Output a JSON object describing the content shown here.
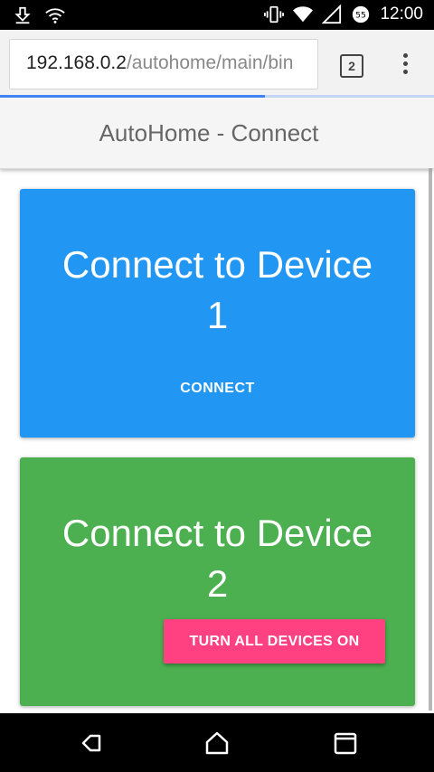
{
  "status_bar": {
    "time": "12:00",
    "battery_level": "55",
    "icons": [
      "download-icon",
      "wifi-icon",
      "vibrate-icon",
      "wifi-signal-icon",
      "cell-signal-icon",
      "battery-icon"
    ]
  },
  "browser": {
    "url_host": "192.168.0.2",
    "url_path": "/autohome/main/bin",
    "tab_count": "2",
    "load_progress": 0.61
  },
  "page": {
    "title": "AutoHome - Connect"
  },
  "cards": [
    {
      "title_line1": "Connect to Device",
      "title_line2": "1",
      "action_label": "CONNECT",
      "color": "#2196f3"
    },
    {
      "title_line1": "Connect to Device",
      "title_line2": "2",
      "action_label": "TURN ALL DEVICES ON",
      "color": "#4caf50",
      "action_color": "#ff4081"
    }
  ],
  "nav_bar": {
    "icons": [
      "back-icon",
      "home-icon",
      "recents-icon"
    ]
  }
}
